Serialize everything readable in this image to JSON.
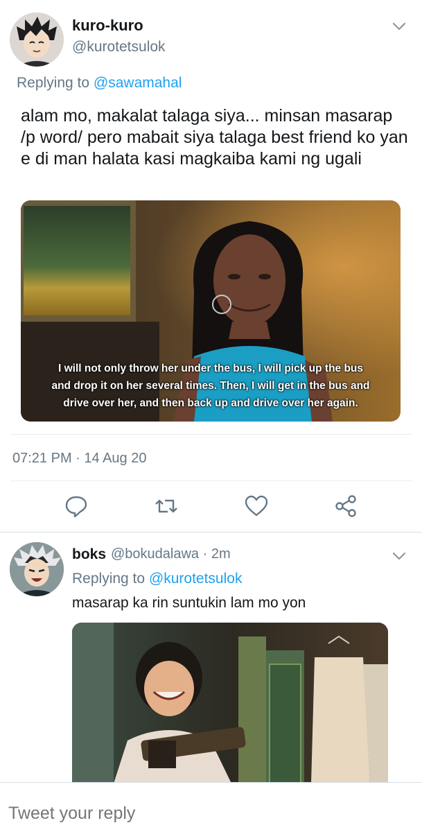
{
  "main_tweet": {
    "display_name": "kuro-kuro",
    "handle": "@kurotetsulok",
    "replying_prefix": "Replying to",
    "replying_to": "@sawamahal",
    "text": "alam mo, makalat talaga siya... minsan masarap /p word/ pero mabait siya talaga best friend ko yan e di man halata kasi magkaiba kami ng ugali",
    "media_caption": "I will not only throw her under the bus, I will pick up the bus\nand drop it on her several times. Then, I will get in the bus and\ndrive over her, and then back up and drive over her again.",
    "timestamp": "07:21 PM · 14 Aug 20",
    "actions": [
      "reply-icon",
      "retweet-icon",
      "like-icon",
      "share-icon"
    ]
  },
  "reply_tweet": {
    "display_name": "boks",
    "handle_time": "@bokudalawa · 2m",
    "replying_prefix": "Replying to",
    "replying_to": "@kurotetsulok",
    "text": "masarap ka rin suntukin lam mo yon"
  },
  "composer": {
    "placeholder": "Tweet your reply"
  },
  "colors": {
    "link": "#1da1f2",
    "secondary_text": "#657786",
    "divider": "#e6ecf0"
  }
}
